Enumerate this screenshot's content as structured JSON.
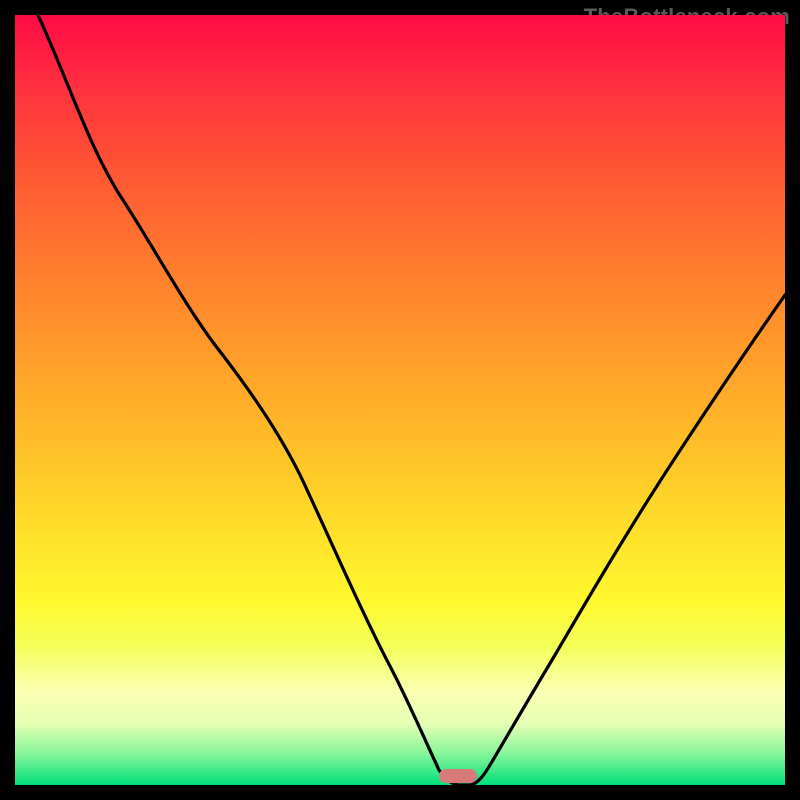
{
  "watermark": "TheBottleneck.com",
  "colors": {
    "frame_bg": "#000000",
    "curve_stroke": "#000000",
    "marker_fill": "#d77b7a",
    "gradient_top": "#ff0a46",
    "gradient_bottom": "#00e07a"
  },
  "chart_data": {
    "type": "line",
    "title": "",
    "xlabel": "",
    "ylabel": "",
    "xlim": [
      0,
      100
    ],
    "ylim": [
      0,
      100
    ],
    "grid": false,
    "series": [
      {
        "name": "bottleneck-curve",
        "x": [
          3,
          8,
          14,
          20,
          26,
          32,
          38,
          44,
          49,
          53,
          55,
          57,
          59,
          61,
          65,
          72,
          80,
          88,
          96,
          100
        ],
        "y": [
          100,
          88,
          76,
          66,
          57,
          48,
          38,
          27,
          15,
          6,
          2,
          0,
          0,
          2,
          8,
          20,
          34,
          47,
          58,
          64
        ]
      }
    ],
    "annotations": [
      {
        "name": "minimum-marker",
        "x": 57.5,
        "y": 0.5,
        "shape": "pill"
      }
    ]
  }
}
